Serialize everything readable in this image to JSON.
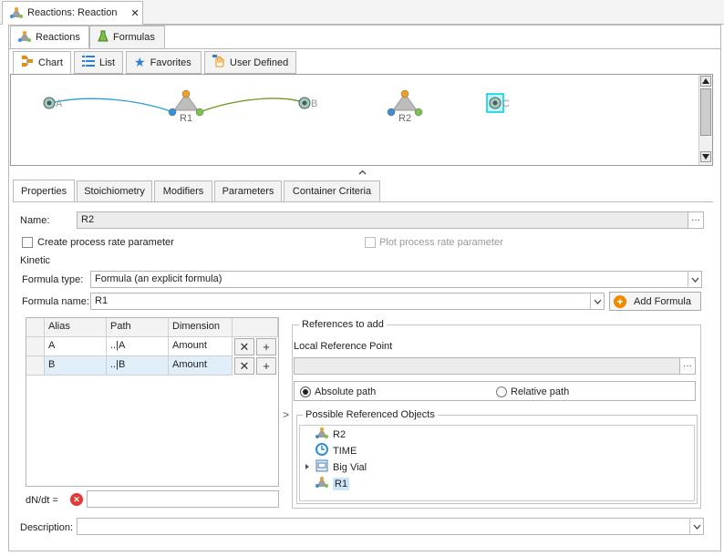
{
  "window": {
    "tab_title": "Reactions: Reaction",
    "close_glyph": "✕"
  },
  "top_tabs": [
    {
      "label": "Reactions",
      "icon": "reaction-icon"
    },
    {
      "label": "Formulas",
      "icon": "flask-icon"
    }
  ],
  "view_tabs": [
    {
      "label": "Chart",
      "icon": "chart-icon"
    },
    {
      "label": "List",
      "icon": "list-icon"
    },
    {
      "label": "Favorites",
      "icon": "star-icon"
    },
    {
      "label": "User Defined",
      "icon": "hand-icon"
    }
  ],
  "diagram": {
    "nodes": [
      {
        "label": "A"
      },
      {
        "label": "R1"
      },
      {
        "label": "B"
      },
      {
        "label": "R2"
      },
      {
        "label": "C"
      }
    ],
    "colors": {
      "left_link": "#2a9fd6",
      "right_link": "#6a9a2a",
      "top_port": "#f0a020",
      "left_port": "#3a8fd6",
      "right_port": "#7cc24a",
      "selection": "#00e0ff"
    }
  },
  "collapse_glyph": "^",
  "detail_tabs": [
    "Properties",
    "Stoichiometry",
    "Modifiers",
    "Parameters",
    "Container Criteria"
  ],
  "properties": {
    "name_label": "Name:",
    "name_value": "R2",
    "name_button": "···",
    "create_rate_param": "Create process rate parameter",
    "plot_rate_param": "Plot process rate parameter",
    "kinetic_label": "Kinetic",
    "formula_type_label": "Formula type:",
    "formula_type_value": "Formula (an explicit formula)",
    "formula_name_label": "Formula name:",
    "formula_name_value": "R1",
    "add_formula": "Add Formula"
  },
  "grid": {
    "headers": [
      "Alias",
      "Path",
      "Dimension"
    ],
    "rows": [
      {
        "alias": "A",
        "path": "..|A",
        "dimension": "Amount"
      },
      {
        "alias": "B",
        "path": "..|B",
        "dimension": "Amount"
      }
    ],
    "remove_glyph": "✕",
    "add_glyph": "+"
  },
  "dndt": {
    "label": "dN/dt =",
    "value": ""
  },
  "expand_glyph": ">",
  "references": {
    "title": "References to add",
    "local_ref_label": "Local Reference Point",
    "local_ref_value": "",
    "ref_button": "···",
    "absolute_path": "Absolute path",
    "relative_path": "Relative path",
    "absolute_selected": true,
    "possible_title": "Possible Referenced Objects",
    "tree": [
      {
        "label": "R2",
        "icon": "reaction-icon",
        "expandable": false,
        "selected": false
      },
      {
        "label": "TIME",
        "icon": "clock-icon",
        "expandable": false,
        "selected": false
      },
      {
        "label": "Big Vial",
        "icon": "container-icon",
        "expandable": true,
        "selected": false
      },
      {
        "label": "R1",
        "icon": "reaction-icon",
        "expandable": false,
        "selected": true
      }
    ]
  },
  "description": {
    "label": "Description:",
    "value": ""
  },
  "accent": {
    "selection_row": "#dfeef9",
    "tree_selected": "#cce4f7",
    "error": "#e53935",
    "add_orange": "#f08a00"
  }
}
